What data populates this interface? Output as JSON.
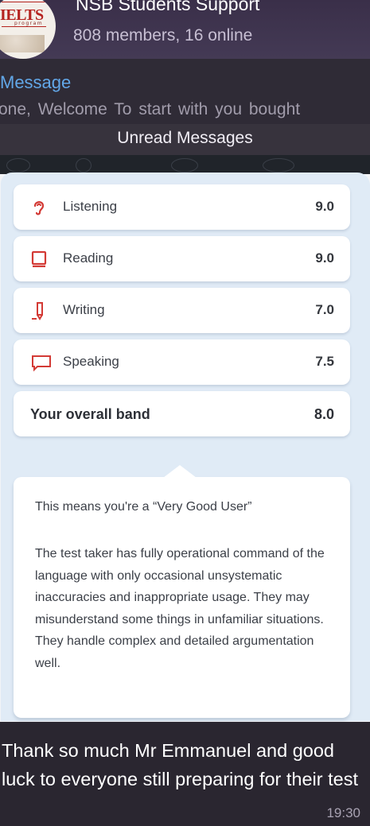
{
  "chat": {
    "avatar_text": "IELTS",
    "avatar_subtext": "program",
    "title": "NSB Students Support",
    "subtitle": "808 members, 16 online"
  },
  "pinned": {
    "label": "Message",
    "text": "one,  Welcome  To start with you bought"
  },
  "unread": {
    "label": "Unread Messages"
  },
  "results": {
    "scores": [
      {
        "name": "Listening",
        "value": "9.0",
        "icon": "ear-icon",
        "color": "#d33a35"
      },
      {
        "name": "Reading",
        "value": "9.0",
        "icon": "book-icon",
        "color": "#d33a35"
      },
      {
        "name": "Writing",
        "value": "7.0",
        "icon": "pencil-icon",
        "color": "#d33a35"
      },
      {
        "name": "Speaking",
        "value": "7.5",
        "icon": "speech-bubble-icon",
        "color": "#d33a35"
      }
    ],
    "overall_label": "Your overall band",
    "overall_value": "8.0",
    "description_title": "This means you're a “Very Good User”",
    "description_body": "The test taker has fully operational command of the language with only occasional unsystematic inaccuracies and inappropriate usage. They may misunderstand some things in unfamiliar situations. They handle complex and detailed argumentation well."
  },
  "message": {
    "caption": "Thank so much Mr Emmanuel and good luck to everyone still preparing for their test",
    "time": "19:30"
  },
  "colors": {
    "accent": "#62a7e8",
    "icon_red": "#d33a35",
    "panel_bg": "#e0ebf6"
  }
}
